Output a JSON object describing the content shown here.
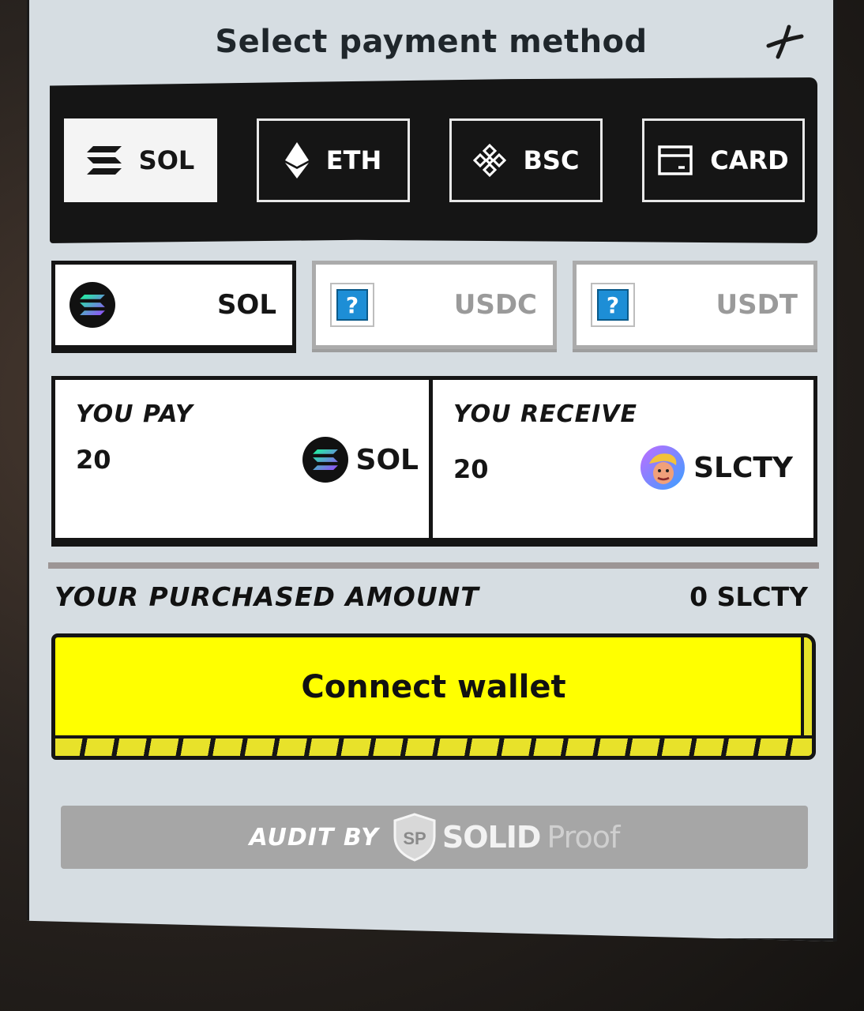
{
  "title": "Select payment method",
  "networks": [
    {
      "label": "SOL",
      "icon": "solana-icon",
      "active": true
    },
    {
      "label": "ETH",
      "icon": "ethereum-icon",
      "active": false
    },
    {
      "label": "BSC",
      "icon": "bnb-icon",
      "active": false
    },
    {
      "label": "CARD",
      "icon": "card-icon",
      "active": false
    }
  ],
  "tokens": [
    {
      "label": "SOL",
      "icon": "solana-coin-icon",
      "active": true
    },
    {
      "label": "USDC",
      "icon": "question-icon",
      "active": false
    },
    {
      "label": "USDT",
      "icon": "question-icon",
      "active": false
    }
  ],
  "pay": {
    "label": "YOU PAY",
    "value": "20",
    "currency": "SOL"
  },
  "receive": {
    "label": "YOU RECEIVE",
    "value": "20",
    "currency": "SLCTY"
  },
  "purchased": {
    "label": "YOUR PURCHASED AMOUNT",
    "value": "0 SLCTY"
  },
  "connect": {
    "label": "Connect wallet"
  },
  "audit": {
    "label": "AUDIT BY",
    "brand_strong": "SOLID",
    "brand_light": "Proof",
    "logo_text": "SP"
  },
  "colors": {
    "accent": "#ffff00",
    "panel": "#d6dde2",
    "dark": "#151515"
  }
}
